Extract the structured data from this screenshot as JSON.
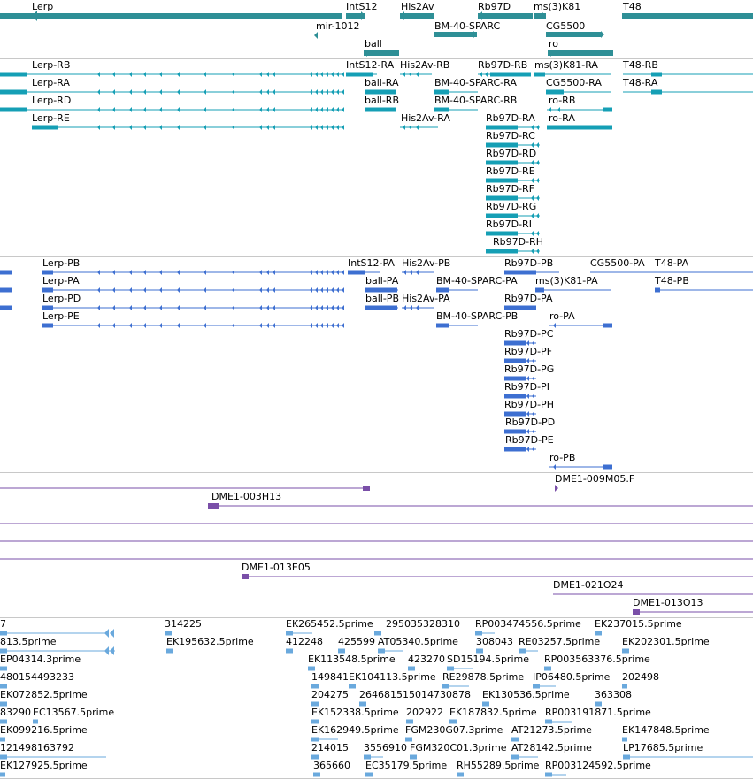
{
  "tracks": {
    "genes": {
      "colors": {
        "feature": "#2e8f96",
        "separator": "#c8c8c8"
      },
      "labels": [
        "Lerp",
        "IntS12",
        "His2Av",
        "Rb97D",
        "ms(3)K81",
        "T48",
        "mir-1012",
        "BM-40-SPARC",
        "CG5500",
        "ball",
        "ro"
      ]
    },
    "transcripts": {
      "colors": {
        "feature": "#159fb5"
      },
      "labels": [
        "Lerp-RB",
        "Lerp-RA",
        "Lerp-RD",
        "Lerp-RE",
        "IntS12-RA",
        "His2Av-RB",
        "Rb97D-RB",
        "ms(3)K81-RA",
        "T48-RB",
        "ball-RA",
        "BM-40-SPARC-RA",
        "CG5500-RA",
        "T48-RA",
        "ball-RB",
        "BM-40-SPARC-RB",
        "ro-RB",
        "His2Av-RA",
        "Rb97D-RA",
        "ro-RA",
        "Rb97D-RC",
        "Rb97D-RD",
        "Rb97D-RE",
        "Rb97D-RF",
        "Rb97D-RG",
        "Rb97D-RI",
        "Rb97D-RH"
      ]
    },
    "proteins": {
      "colors": {
        "feature": "#3d6fd1"
      },
      "labels": [
        "Lerp-PB",
        "IntS12-PA",
        "His2Av-PB",
        "Rb97D-PB",
        "CG5500-PA",
        "T48-PA",
        "Lerp-PA",
        "ball-PA",
        "BM-40-SPARC-PA",
        "ms(3)K81-PA",
        "T48-PB",
        "Lerp-PD",
        "ball-PB",
        "His2Av-PA",
        "Rb97D-PA",
        "Lerp-PE",
        "BM-40-SPARC-PB",
        "ro-PA",
        "Rb97D-PC",
        "Rb97D-PF",
        "Rb97D-PG",
        "Rb97D-PI",
        "Rb97D-PH",
        "Rb97D-PD",
        "Rb97D-PE",
        "ro-PB"
      ]
    },
    "clones": {
      "colors": {
        "feature": "#7a4fa8"
      },
      "labels": [
        "DME1-009M05.F",
        "DME1-003H13",
        "DME1-013E05",
        "DME1-021O24",
        "DME1-013O13"
      ]
    },
    "ests": {
      "colors": {
        "feature": "#6aa9dd"
      },
      "labels": [
        "7",
        "314225",
        "EK265452.5prime",
        "295035328310",
        "RP003474556.5prime",
        "EK237015.5prime",
        "813.5prime",
        "EK195632.5prime",
        "412248",
        "425599",
        "AT05340.5prime",
        "308043",
        "RE03257.5prime",
        "EK202301.5prime",
        "EP04314.3prime",
        "EK113548.5prime",
        "423270",
        "SD15194.5prime",
        "RP003563376.5prime",
        "480154493233",
        "149841",
        "EK104113.5prime",
        "RE29878.5prime",
        "IP06480.5prime",
        "202498",
        "EK072852.5prime",
        "204275",
        "264681515014730878",
        "EK130536.5prime",
        "363308",
        "83290",
        "EC13567.5prime",
        "EK152338.5prime",
        "202922",
        "EK187832.5prime",
        "RP003191871.5prime",
        "EK099216.5prime",
        "EK162949.5prime",
        "FGM230G07.3prime",
        "AT21273.5prime",
        "EK147848.5prime",
        "121498163792",
        "214015",
        "3556910",
        "FGM320C01.3prime",
        "AT28142.5prime",
        "LP17685.5prime",
        "EK127925.5prime",
        "365660",
        "EC35179.5prime",
        "RH55289.5prime",
        "RP003124592.5prime"
      ]
    }
  }
}
